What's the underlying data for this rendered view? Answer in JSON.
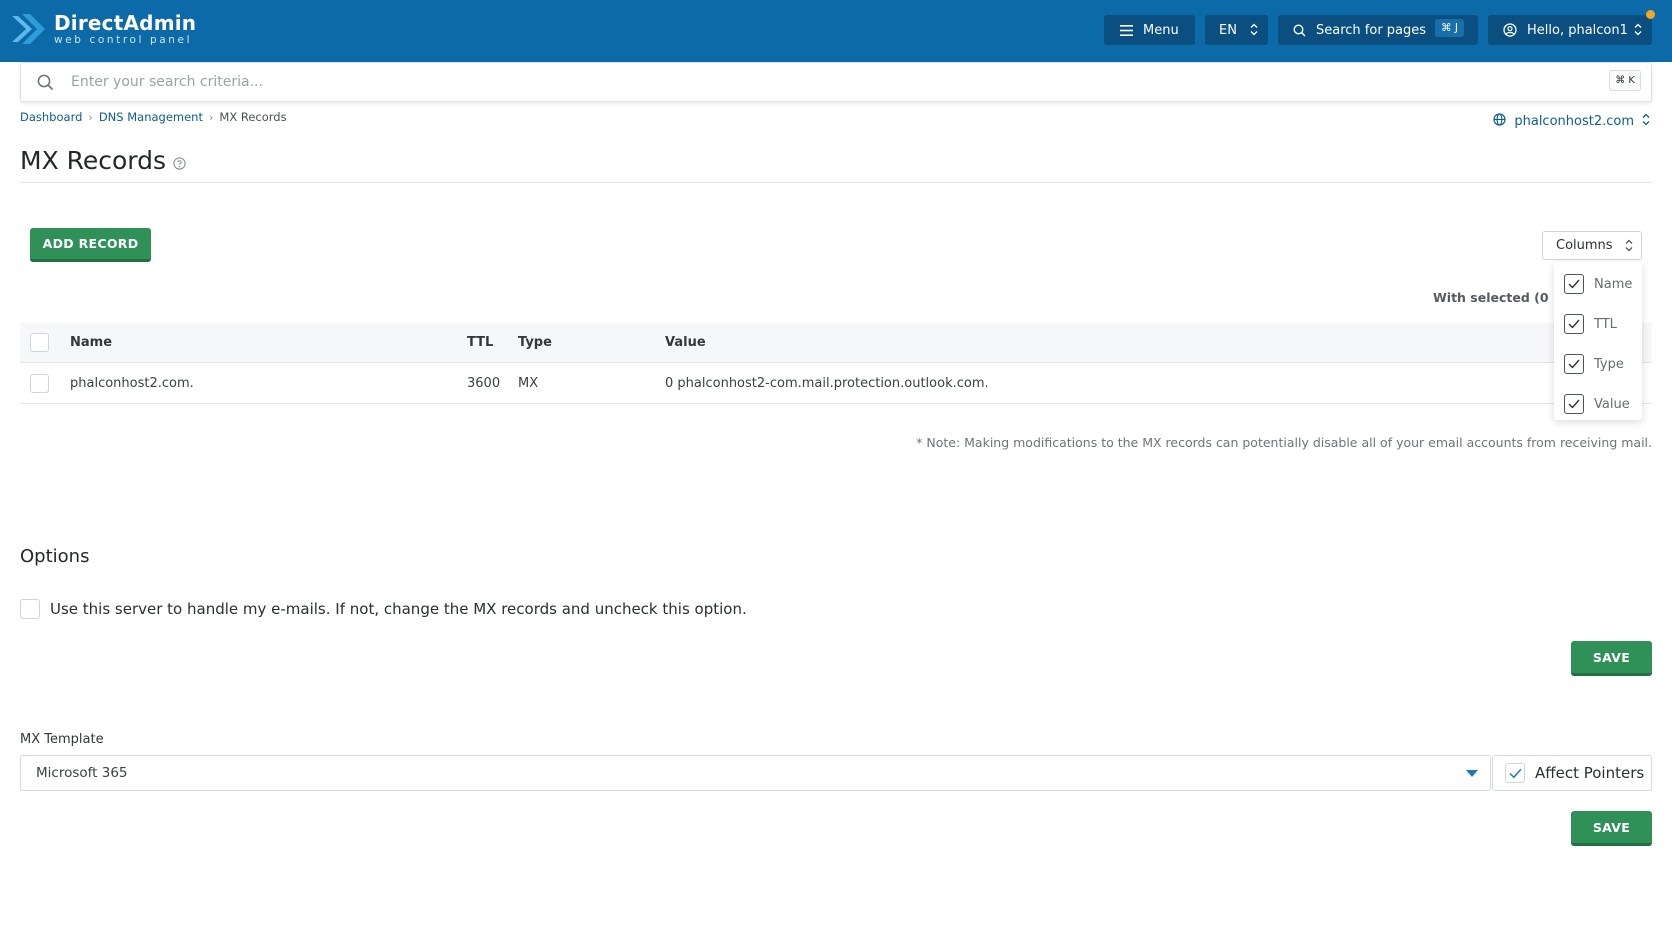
{
  "header": {
    "brand_title": "DirectAdmin",
    "brand_subtitle": "web control panel",
    "menu_label": "Menu",
    "lang_label": "EN",
    "search_pages_label": "Search for pages",
    "search_pages_shortcut": "⌘ J",
    "user_label": "Hello, phalcon1",
    "accent_color": "#0c6aa8"
  },
  "global_search": {
    "placeholder": "Enter your search criteria...",
    "shortcut": "⌘ K"
  },
  "breadcrumb": {
    "items": [
      "Dashboard",
      "DNS Management",
      "MX Records"
    ]
  },
  "domain_selector": {
    "value": "phalconhost2.com"
  },
  "page": {
    "title": "MX Records"
  },
  "toolbar": {
    "add_record_label": "ADD RECORD",
    "columns_label": "Columns",
    "with_selected_label": "With selected (0 / 1)"
  },
  "columns_menu": {
    "items": [
      {
        "label": "Name",
        "checked": true
      },
      {
        "label": "TTL",
        "checked": true
      },
      {
        "label": "Type",
        "checked": true
      },
      {
        "label": "Value",
        "checked": true
      }
    ]
  },
  "table": {
    "headers": {
      "name": "Name",
      "ttl": "TTL",
      "type": "Type",
      "value": "Value"
    },
    "rows": [
      {
        "name": "phalconhost2.com.",
        "ttl": "3600",
        "type": "MX",
        "value": "0 phalconhost2-com.mail.protection.outlook.com."
      }
    ]
  },
  "note": "* Note: Making modifications to the MX records can potentially disable all of your email accounts from receiving mail.",
  "options": {
    "title": "Options",
    "use_server_label": "Use this server to handle my e-mails. If not, change the MX records and uncheck this option.",
    "use_server_checked": false,
    "save_label": "SAVE"
  },
  "mx_template": {
    "label": "MX Template",
    "selected": "Microsoft 365",
    "affect_pointers_label": "Affect Pointers",
    "affect_pointers_checked": true,
    "save_label": "SAVE"
  }
}
